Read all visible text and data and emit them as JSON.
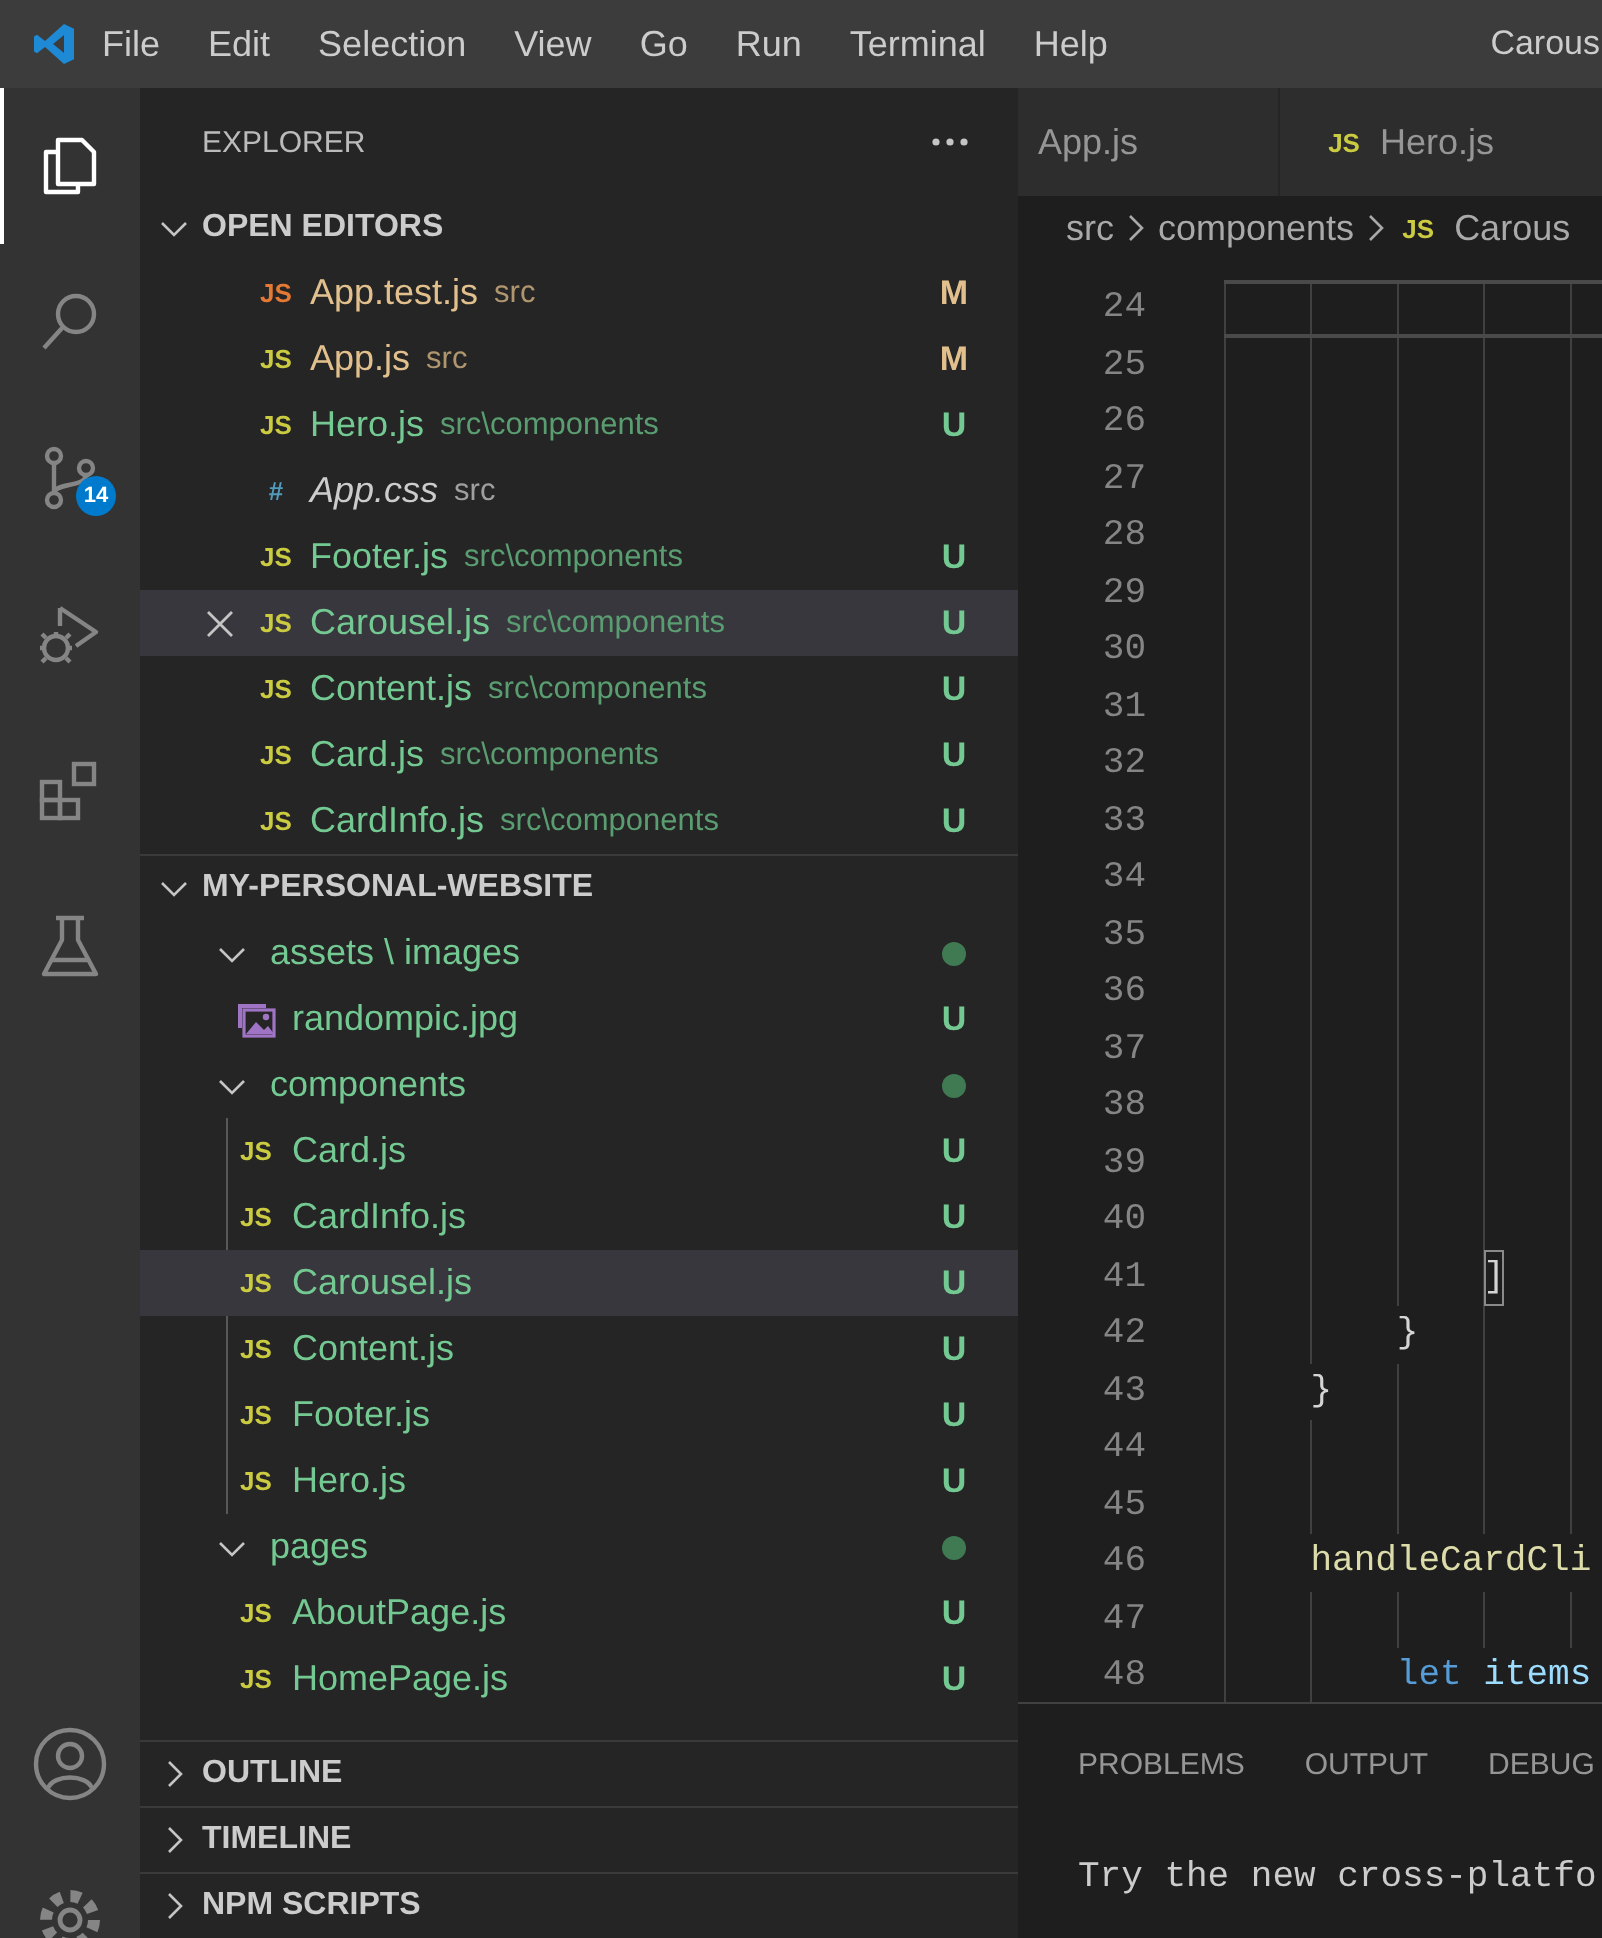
{
  "menu_bar": {
    "items": [
      "File",
      "Edit",
      "Selection",
      "View",
      "Go",
      "Run",
      "Terminal",
      "Help"
    ],
    "title": "Carous"
  },
  "activity_bar": {
    "items": [
      {
        "kind": "explorer",
        "selected": true
      },
      {
        "kind": "search",
        "selected": false
      },
      {
        "kind": "source-control",
        "selected": false,
        "badge": "14"
      },
      {
        "kind": "run-debug",
        "selected": false
      },
      {
        "kind": "extensions",
        "selected": false
      },
      {
        "kind": "testing",
        "selected": false
      }
    ],
    "bottom": [
      {
        "kind": "account"
      },
      {
        "kind": "settings"
      }
    ]
  },
  "explorer": {
    "title": "EXPLORER",
    "sections": [
      {
        "kind": "open-editors",
        "title": "OPEN EDITORS",
        "expanded": true,
        "items": [
          {
            "icon": {
              "kind": "text",
              "text": "JS",
              "color": "#e37933"
            },
            "name": "App.test.js",
            "path": "src",
            "git": "M",
            "color": "#e2c08d",
            "preview": false,
            "selected": false
          },
          {
            "icon": {
              "kind": "text",
              "text": "JS",
              "color": "#cbcb41"
            },
            "name": "App.js",
            "path": "src",
            "git": "M",
            "color": "#e2c08d",
            "preview": false,
            "selected": false
          },
          {
            "icon": {
              "kind": "text",
              "text": "JS",
              "color": "#cbcb41"
            },
            "name": "Hero.js",
            "path": "src\\components",
            "git": "U",
            "color": "#73c991",
            "preview": false,
            "selected": false
          },
          {
            "icon": {
              "kind": "text",
              "text": "#",
              "color": "#519aba"
            },
            "name": "App.css",
            "path": "src",
            "color": "#cccccc",
            "preview": true,
            "selected": false
          },
          {
            "icon": {
              "kind": "text",
              "text": "JS",
              "color": "#cbcb41"
            },
            "name": "Footer.js",
            "path": "src\\components",
            "git": "U",
            "color": "#73c991",
            "preview": false,
            "selected": false
          },
          {
            "icon": {
              "kind": "text",
              "text": "JS",
              "color": "#cbcb41"
            },
            "name": "Carousel.js",
            "path": "src\\components",
            "git": "U",
            "color": "#73c991",
            "preview": false,
            "selected": true
          },
          {
            "icon": {
              "kind": "text",
              "text": "JS",
              "color": "#cbcb41"
            },
            "name": "Content.js",
            "path": "src\\components",
            "git": "U",
            "color": "#73c991",
            "preview": false,
            "selected": false
          },
          {
            "icon": {
              "kind": "text",
              "text": "JS",
              "color": "#cbcb41"
            },
            "name": "Card.js",
            "path": "src\\components",
            "git": "U",
            "color": "#73c991",
            "preview": false,
            "selected": false
          },
          {
            "icon": {
              "kind": "text",
              "text": "JS",
              "color": "#cbcb41"
            },
            "name": "CardInfo.js",
            "path": "src\\components",
            "git": "U",
            "color": "#73c991",
            "preview": false,
            "selected": false
          }
        ]
      },
      {
        "kind": "tree",
        "title": "MY-PERSONAL-WEBSITE",
        "expanded": true,
        "children": [
          {
            "kind": "folder",
            "name": "assets \\ images",
            "expanded": true,
            "dot": true,
            "color": "#73c991",
            "selected": false,
            "children": [
              {
                "kind": "file",
                "icon": {
                  "kind": "image"
                },
                "name": "randompic.jpg",
                "git": "U",
                "color": "#73c991",
                "selected": false
              }
            ]
          },
          {
            "kind": "folder",
            "name": "components",
            "expanded": true,
            "dot": true,
            "color": "#73c991",
            "selected": false,
            "children": [
              {
                "kind": "file",
                "icon": {
                  "kind": "text",
                  "text": "JS",
                  "color": "#cbcb41"
                },
                "name": "Card.js",
                "git": "U",
                "color": "#73c991",
                "selected": false
              },
              {
                "kind": "file",
                "icon": {
                  "kind": "text",
                  "text": "JS",
                  "color": "#cbcb41"
                },
                "name": "CardInfo.js",
                "git": "U",
                "color": "#73c991",
                "selected": false
              },
              {
                "kind": "file",
                "icon": {
                  "kind": "text",
                  "text": "JS",
                  "color": "#cbcb41"
                },
                "name": "Carousel.js",
                "git": "U",
                "color": "#73c991",
                "selected": true
              },
              {
                "kind": "file",
                "icon": {
                  "kind": "text",
                  "text": "JS",
                  "color": "#cbcb41"
                },
                "name": "Content.js",
                "git": "U",
                "color": "#73c991",
                "selected": false
              },
              {
                "kind": "file",
                "icon": {
                  "kind": "text",
                  "text": "JS",
                  "color": "#cbcb41"
                },
                "name": "Footer.js",
                "git": "U",
                "color": "#73c991",
                "selected": false
              },
              {
                "kind": "file",
                "icon": {
                  "kind": "text",
                  "text": "JS",
                  "color": "#cbcb41"
                },
                "name": "Hero.js",
                "git": "U",
                "color": "#73c991",
                "selected": false
              }
            ]
          },
          {
            "kind": "folder",
            "name": "pages",
            "expanded": true,
            "dot": true,
            "color": "#73c991",
            "selected": false,
            "children": [
              {
                "kind": "file",
                "icon": {
                  "kind": "text",
                  "text": "JS",
                  "color": "#cbcb41"
                },
                "name": "AboutPage.js",
                "git": "U",
                "color": "#73c991",
                "selected": false
              },
              {
                "kind": "file",
                "icon": {
                  "kind": "text",
                  "text": "JS",
                  "color": "#cbcb41"
                },
                "name": "HomePage.js",
                "git": "U",
                "color": "#73c991",
                "selected": false
              }
            ]
          }
        ]
      },
      {
        "kind": "collapsed",
        "title": "OUTLINE",
        "expanded": false
      },
      {
        "kind": "collapsed",
        "title": "TIMELINE",
        "expanded": false
      },
      {
        "kind": "collapsed",
        "title": "NPM SCRIPTS",
        "expanded": false
      }
    ]
  },
  "editor": {
    "tabs": [
      {
        "label": "App.js",
        "selected": false
      },
      {
        "label": "Hero.js",
        "icon": {
          "text": "JS",
          "color": "#cbcb41"
        },
        "selected": false
      }
    ],
    "breadcrumbs": [
      {
        "label": "src"
      },
      {
        "label": "components"
      },
      {
        "label": "Carous",
        "icon": {
          "text": "JS",
          "color": "#cbcb41"
        }
      }
    ],
    "lines": [
      {
        "number": "24",
        "current": true
      },
      {
        "number": "25",
        "current": false
      },
      {
        "number": "26",
        "current": false
      },
      {
        "number": "27",
        "current": false
      },
      {
        "number": "28",
        "current": false
      },
      {
        "number": "29",
        "current": false
      },
      {
        "number": "30",
        "current": false
      },
      {
        "number": "31",
        "current": false
      },
      {
        "number": "32",
        "current": false
      },
      {
        "number": "33",
        "current": false
      },
      {
        "number": "34",
        "current": false
      },
      {
        "number": "35",
        "current": false
      },
      {
        "number": "36",
        "current": false
      },
      {
        "number": "37",
        "current": false
      },
      {
        "number": "38",
        "current": false
      },
      {
        "number": "39",
        "current": false
      },
      {
        "number": "40",
        "current": false
      },
      {
        "number": "41",
        "current": false,
        "tokens": [
          {
            "kind": "bracket-match",
            "text": "            ]"
          }
        ]
      },
      {
        "number": "42",
        "current": false,
        "tokens": [
          {
            "kind": "punct",
            "text": "        }"
          }
        ]
      },
      {
        "number": "43",
        "current": false,
        "tokens": [
          {
            "kind": "punct",
            "text": "    }"
          }
        ]
      },
      {
        "number": "44",
        "current": false
      },
      {
        "number": "45",
        "current": false
      },
      {
        "number": "46",
        "current": false,
        "tokens": [
          {
            "kind": "function",
            "text": "    handleCardCli"
          }
        ]
      },
      {
        "number": "47",
        "current": false
      },
      {
        "number": "48",
        "current": false,
        "tokens": [
          {
            "kind": "keyword",
            "text": "        let"
          },
          {
            "kind": "variable",
            "text": " items"
          }
        ]
      }
    ]
  },
  "panel": {
    "tabs": [
      {
        "label": "PROBLEMS",
        "selected": false
      },
      {
        "label": "OUTPUT",
        "selected": false
      },
      {
        "label": "DEBUG",
        "selected": false
      }
    ],
    "terminal_text": "Try the new cross-platfo"
  }
}
